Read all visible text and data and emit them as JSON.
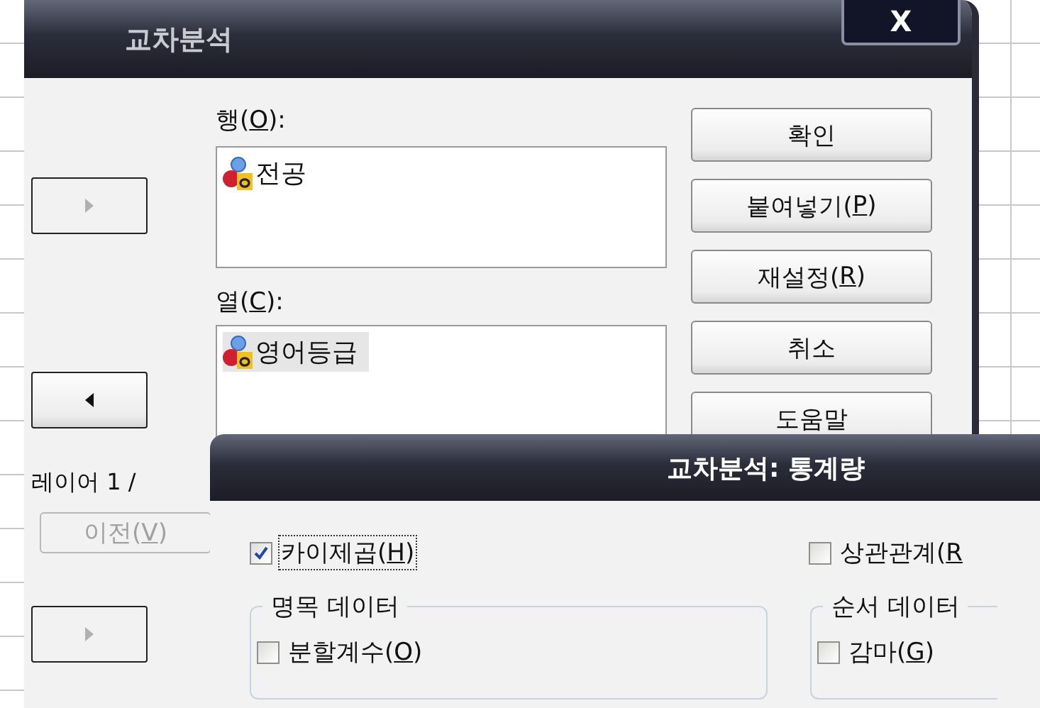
{
  "back_dialog": {
    "title": "교차분석",
    "close_label": "X",
    "move_buttons": [
      {
        "kind": "right",
        "disabled": true
      },
      {
        "kind": "left",
        "disabled": false
      },
      {
        "kind": "right",
        "disabled": true
      }
    ],
    "row_label": [
      "행(",
      "O",
      "):"
    ],
    "row_items": [
      {
        "label": "전공",
        "selected": false
      }
    ],
    "column_label": [
      "열(",
      "C",
      "):"
    ],
    "column_items": [
      {
        "label": "영어등급",
        "selected": true
      }
    ],
    "layer_label": "레이어 1 /",
    "previous_button": {
      "label": [
        "이전(",
        "V",
        ")"
      ],
      "disabled": true
    },
    "action_buttons": [
      {
        "label": [
          "확인"
        ]
      },
      {
        "label": [
          "붙여넣기(",
          "P",
          ")"
        ]
      },
      {
        "label": [
          "재설정(",
          "R",
          ")"
        ]
      },
      {
        "label": [
          "취소"
        ]
      },
      {
        "label": [
          "도움말"
        ]
      }
    ]
  },
  "front_dialog": {
    "title": "교차분석: 통계량",
    "checks": [
      {
        "label": [
          "카이제곱(",
          "H",
          ")"
        ],
        "checked": true,
        "focused": true
      },
      {
        "label": [
          "상관관계(",
          "R"
        ],
        "checked": false,
        "focused": false
      }
    ],
    "groups": [
      {
        "title": "명목 데이터",
        "items": [
          {
            "label": [
              "분할계수(",
              "O",
              ")"
            ],
            "checked": false
          }
        ]
      },
      {
        "title": "순서 데이터",
        "items": [
          {
            "label": [
              "감마(",
              "G",
              ")"
            ],
            "checked": false
          }
        ]
      }
    ]
  }
}
